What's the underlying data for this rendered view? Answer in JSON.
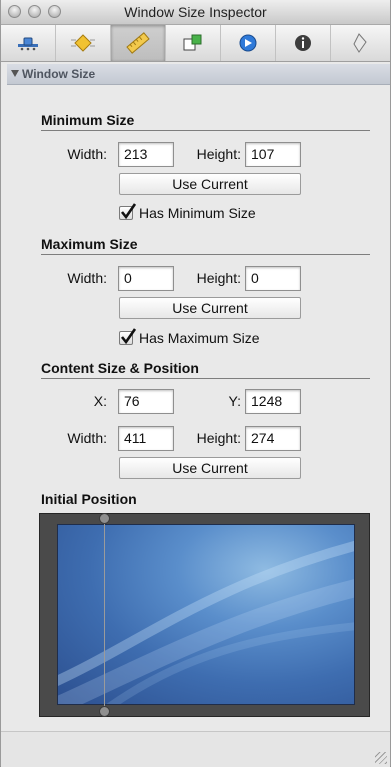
{
  "window": {
    "title": "Window Size Inspector"
  },
  "toolbar": {
    "tools": [
      {
        "icon": "attributes-icon"
      },
      {
        "icon": "effects-icon"
      },
      {
        "icon": "size-ruler-icon",
        "selected": true
      },
      {
        "icon": "connections-icon"
      },
      {
        "icon": "bindings-icon"
      },
      {
        "icon": "identity-info-icon"
      },
      {
        "icon": "applescript-icon"
      }
    ]
  },
  "panel": {
    "title": "Window Size"
  },
  "min_size": {
    "heading": "Minimum Size",
    "width_label": "Width:",
    "width": "213",
    "height_label": "Height:",
    "height": "107",
    "button": "Use Current",
    "checkbox": "Has Minimum Size",
    "checked": true
  },
  "max_size": {
    "heading": "Maximum Size",
    "width_label": "Width:",
    "width": "0",
    "height_label": "Height:",
    "height": "0",
    "button": "Use Current",
    "checkbox": "Has Maximum Size",
    "checked": true
  },
  "content": {
    "heading": "Content Size & Position",
    "x_label": "X:",
    "x": "76",
    "y_label": "Y:",
    "y": "1248",
    "width_label": "Width:",
    "width": "411",
    "height_label": "Height:",
    "height": "274",
    "button": "Use Current"
  },
  "initial_position": {
    "heading": "Initial Position"
  }
}
